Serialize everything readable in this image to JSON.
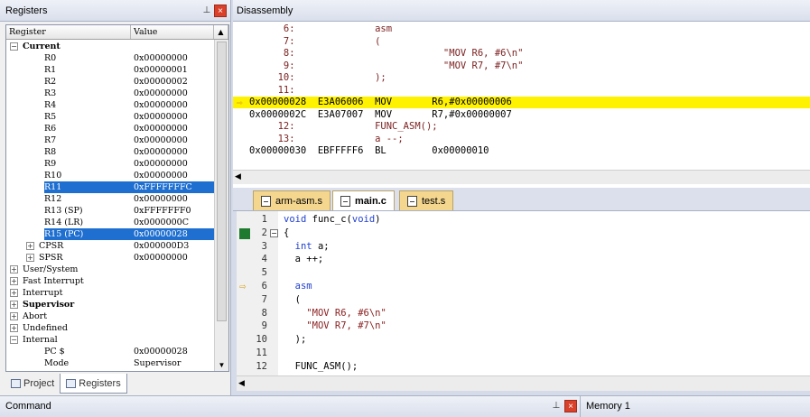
{
  "registers_pane": {
    "title": "Registers",
    "columns": {
      "register": "Register",
      "value": "Value"
    },
    "rows": [
      {
        "name": "Current",
        "value": "",
        "bold": true,
        "toggle": "−",
        "indent": 0
      },
      {
        "name": "R0",
        "value": "0x00000000",
        "indent": 2
      },
      {
        "name": "R1",
        "value": "0x00000001",
        "indent": 2
      },
      {
        "name": "R2",
        "value": "0x00000002",
        "indent": 2
      },
      {
        "name": "R3",
        "value": "0x00000000",
        "indent": 2
      },
      {
        "name": "R4",
        "value": "0x00000000",
        "indent": 2
      },
      {
        "name": "R5",
        "value": "0x00000000",
        "indent": 2
      },
      {
        "name": "R6",
        "value": "0x00000000",
        "indent": 2
      },
      {
        "name": "R7",
        "value": "0x00000000",
        "indent": 2
      },
      {
        "name": "R8",
        "value": "0x00000000",
        "indent": 2
      },
      {
        "name": "R9",
        "value": "0x00000000",
        "indent": 2
      },
      {
        "name": "R10",
        "value": "0x00000000",
        "indent": 2
      },
      {
        "name": "R11",
        "value": "0xFFFFFFFC",
        "indent": 2,
        "selected": true
      },
      {
        "name": "R12",
        "value": "0x00000000",
        "indent": 2
      },
      {
        "name": "R13 (SP)",
        "value": "0xFFFFFFF0",
        "indent": 2
      },
      {
        "name": "R14 (LR)",
        "value": "0x0000000C",
        "indent": 2
      },
      {
        "name": "R15 (PC)",
        "value": "0x00000028",
        "indent": 2,
        "selected": true
      },
      {
        "name": "CPSR",
        "value": "0x000000D3",
        "indent": 2,
        "toggle": "+"
      },
      {
        "name": "SPSR",
        "value": "0x00000000",
        "indent": 2,
        "toggle": "+"
      },
      {
        "name": "User/System",
        "value": "",
        "indent": 0,
        "toggle": "+"
      },
      {
        "name": "Fast Interrupt",
        "value": "",
        "indent": 0,
        "toggle": "+"
      },
      {
        "name": "Interrupt",
        "value": "",
        "indent": 0,
        "toggle": "+"
      },
      {
        "name": "Supervisor",
        "value": "",
        "indent": 0,
        "toggle": "+",
        "bold": true
      },
      {
        "name": "Abort",
        "value": "",
        "indent": 0,
        "toggle": "+"
      },
      {
        "name": "Undefined",
        "value": "",
        "indent": 0,
        "toggle": "+"
      },
      {
        "name": "Internal",
        "value": "",
        "indent": 0,
        "toggle": "−"
      },
      {
        "name": "PC  $",
        "value": "0x00000028",
        "indent": 2
      },
      {
        "name": "Mode",
        "value": "Supervisor",
        "indent": 2
      }
    ],
    "tabs": [
      {
        "label": "Project",
        "active": false
      },
      {
        "label": "Registers",
        "active": true
      }
    ]
  },
  "disassembly": {
    "title": "Disassembly",
    "lines": [
      {
        "text": "      6:              asm",
        "type": "src"
      },
      {
        "text": "      7:              (",
        "type": "src"
      },
      {
        "text": "      8:                          \"MOV R6, #6\\n\"",
        "type": "src"
      },
      {
        "text": "      9:                          \"MOV R7, #7\\n\"",
        "type": "src"
      },
      {
        "text": "     10:              );",
        "type": "src"
      },
      {
        "text": "     11:",
        "type": "src"
      },
      {
        "text": "0x00000028  E3A06006  MOV       R6,#0x00000006",
        "type": "asm",
        "current": true
      },
      {
        "text": "0x0000002C  E3A07007  MOV       R7,#0x00000007",
        "type": "asm"
      },
      {
        "text": "     12:              FUNC_ASM();",
        "type": "src"
      },
      {
        "text": "     13:              a --;",
        "type": "src"
      },
      {
        "text": "0x00000030  EBFFFFF6  BL        0x00000010",
        "type": "asm"
      }
    ]
  },
  "editor": {
    "tabs": [
      {
        "label": "arm-asm.s",
        "active": false
      },
      {
        "label": "main.c",
        "active": true
      },
      {
        "label": "test.s",
        "active": false
      }
    ],
    "lines": [
      {
        "num": "1",
        "parts": [
          {
            "t": "void",
            "c": "kw"
          },
          {
            "t": " func_c(",
            "c": ""
          },
          {
            "t": "void",
            "c": "kw"
          },
          {
            "t": ")",
            "c": ""
          }
        ]
      },
      {
        "num": "2",
        "parts": [
          {
            "t": "{",
            "c": ""
          }
        ],
        "fold": "−",
        "green": true
      },
      {
        "num": "3",
        "parts": [
          {
            "t": "  ",
            "c": ""
          },
          {
            "t": "int",
            "c": "kw"
          },
          {
            "t": " a;",
            "c": ""
          }
        ]
      },
      {
        "num": "4",
        "parts": [
          {
            "t": "  a ++;",
            "c": ""
          }
        ]
      },
      {
        "num": "5",
        "parts": [
          {
            "t": "",
            "c": ""
          }
        ]
      },
      {
        "num": "6",
        "parts": [
          {
            "t": "  ",
            "c": ""
          },
          {
            "t": "asm",
            "c": "kw"
          }
        ],
        "arrow": true
      },
      {
        "num": "7",
        "parts": [
          {
            "t": "  (",
            "c": ""
          }
        ]
      },
      {
        "num": "8",
        "parts": [
          {
            "t": "    ",
            "c": ""
          },
          {
            "t": "\"MOV R6, #6\\n\"",
            "c": "str"
          }
        ]
      },
      {
        "num": "9",
        "parts": [
          {
            "t": "    ",
            "c": ""
          },
          {
            "t": "\"MOV R7, #7\\n\"",
            "c": "str"
          }
        ]
      },
      {
        "num": "10",
        "parts": [
          {
            "t": "  );",
            "c": ""
          }
        ]
      },
      {
        "num": "11",
        "parts": [
          {
            "t": "",
            "c": ""
          }
        ]
      },
      {
        "num": "12",
        "parts": [
          {
            "t": "  FUNC_ASM();",
            "c": ""
          }
        ]
      }
    ]
  },
  "bottom": {
    "command_title": "Command",
    "memory_title": "Memory 1"
  },
  "icons": {
    "pin": "pin-icon",
    "close": "close-icon",
    "current_instruction": "arrow-right-icon"
  },
  "colors": {
    "current_line_highlight": "#fff200",
    "selection": "#1e6fd0",
    "keyword": "#1f3fd0",
    "string": "#8b2222"
  }
}
